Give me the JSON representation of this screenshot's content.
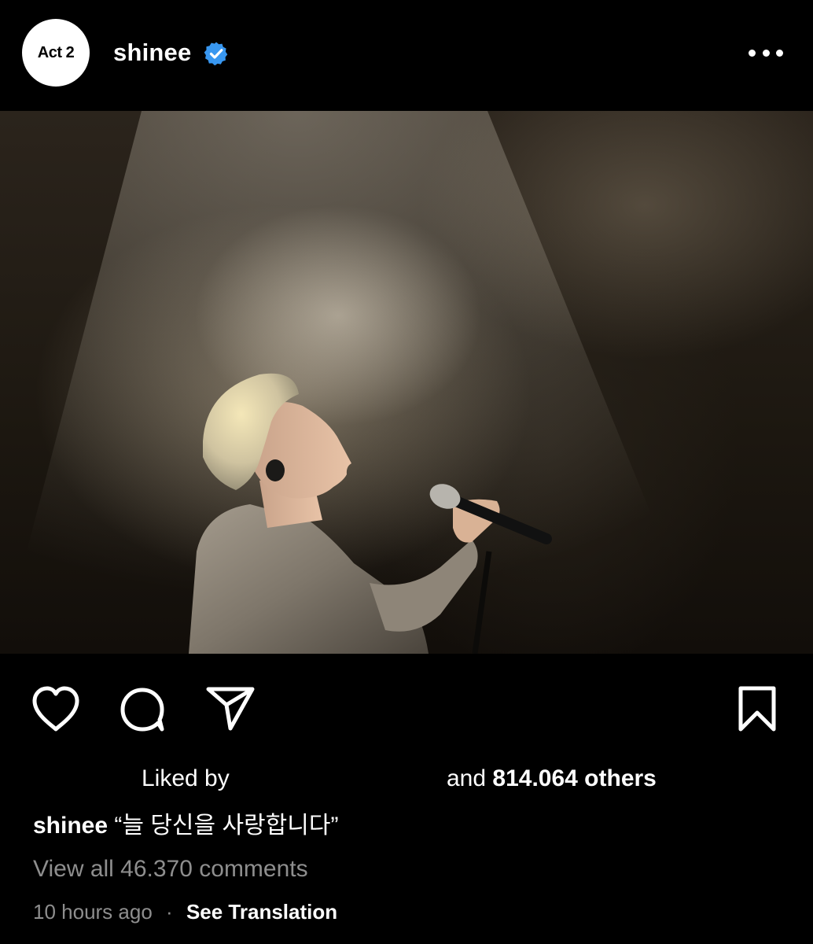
{
  "header": {
    "avatar_text": "Act 2",
    "username": "shinee",
    "verified_icon": "verified-badge-icon",
    "more_icon": "more-options-icon"
  },
  "photo": {
    "description_icon": "post-image"
  },
  "actions": {
    "like_icon": "heart-icon",
    "comment_icon": "comment-icon",
    "share_icon": "send-icon",
    "save_icon": "bookmark-icon"
  },
  "likes": {
    "prefix": "Liked by",
    "and_text": "and",
    "count_text": "814.064 others"
  },
  "caption": {
    "username": "shinee",
    "text": "“늘 당신을 사랑합니다”"
  },
  "comments": {
    "view_all": "View all 46.370 comments"
  },
  "meta": {
    "time": "10 hours ago",
    "dot": "·",
    "translate": "See Translation"
  },
  "colors": {
    "background": "#000000",
    "verified": "#3897f0",
    "muted_text": "#8e8e8e"
  }
}
